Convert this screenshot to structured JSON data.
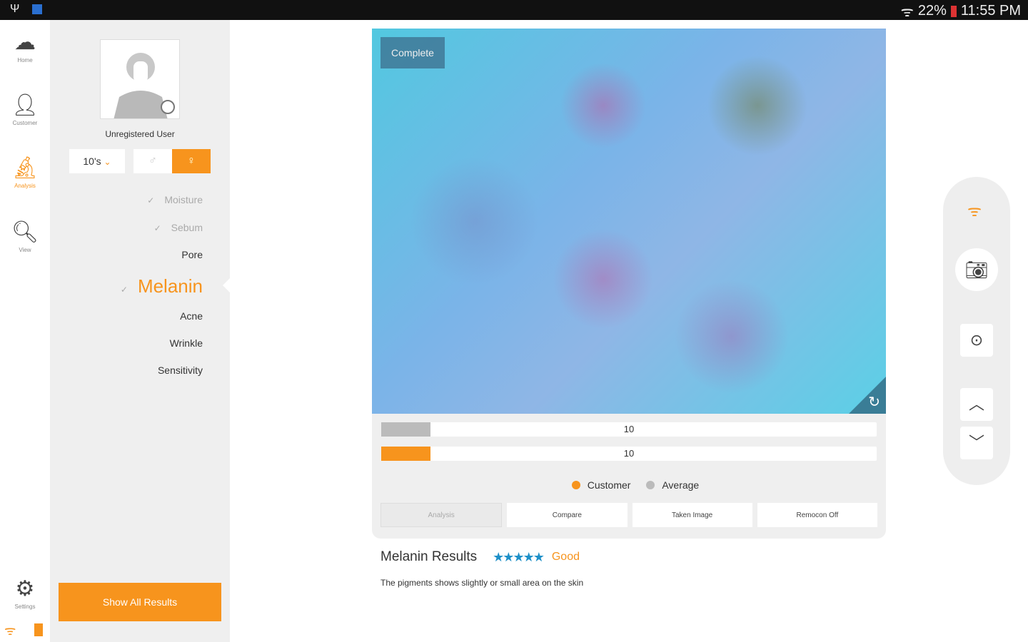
{
  "status_bar": {
    "battery": "22%",
    "time": "11:55 PM"
  },
  "nav": {
    "items": [
      {
        "label": "Home",
        "icon": "home-logo-icon"
      },
      {
        "label": "Customer",
        "icon": "person-icon"
      },
      {
        "label": "Analysis",
        "icon": "microscope-icon",
        "active": true
      },
      {
        "label": "View",
        "icon": "search-icon"
      }
    ],
    "settings": "Settings"
  },
  "profile": {
    "name": "Unregistered User",
    "age": "10's",
    "gender_selected": "female"
  },
  "menu": {
    "items": [
      "Moisture",
      "Sebum",
      "Pore",
      "Melanin",
      "Acne",
      "Wrinkle",
      "Sensitivity"
    ],
    "completed": [
      "Moisture",
      "Sebum"
    ],
    "selected": "Melanin"
  },
  "show_all": "Show All Results",
  "image": {
    "status": "Complete"
  },
  "bars": [
    {
      "series": "Average",
      "value": "10",
      "fill": 0.1,
      "color": "#bbbbbb"
    },
    {
      "series": "Customer",
      "value": "10",
      "fill": 0.1,
      "color": "#f7941d"
    }
  ],
  "legend": [
    {
      "label": "Customer",
      "color": "#f7941d"
    },
    {
      "label": "Average",
      "color": "#bbbbbb"
    }
  ],
  "tabs": [
    "Analysis",
    "Compare",
    "Taken Image",
    "Remocon Off"
  ],
  "results": {
    "title": "Melanin Results",
    "stars": 5,
    "stars_text": "★★★★★",
    "rating": "Good",
    "description": "The pigments shows slightly or small area on the skin"
  },
  "colors": {
    "accent": "#f7941d",
    "star": "#1e90c8"
  }
}
